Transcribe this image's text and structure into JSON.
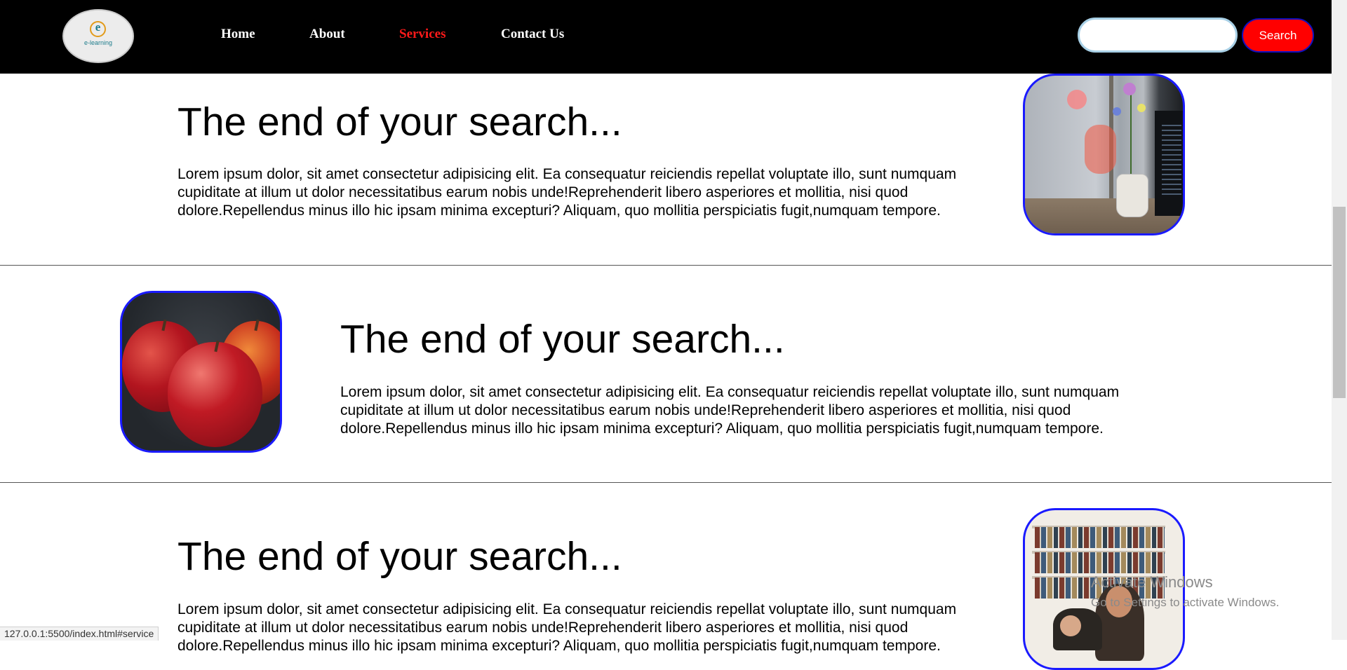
{
  "header": {
    "logo_text": "e-learning",
    "logo_letter": "e",
    "nav": [
      {
        "label": "Home",
        "active": false
      },
      {
        "label": "About",
        "active": false
      },
      {
        "label": "Services",
        "active": true
      },
      {
        "label": "Contact Us",
        "active": false
      }
    ],
    "search": {
      "value": "",
      "placeholder": "",
      "button_label": "Search"
    }
  },
  "sections": [
    {
      "heading": "The end of your search...",
      "text": "Lorem ipsum dolor, sit amet consectetur adipisicing elit. Ea consequatur reiciendis repellat voluptate illo, sunt numquam cupiditate at illum ut dolor necessitatibus earum nobis unde!Reprehenderit libero asperiores et mollitia, nisi quod dolore.Repellendus minus illo hic ipsam minima excepturi? Aliquam, quo mollitia perspiciatis fugit,numquam tempore."
    },
    {
      "heading": "The end of your search...",
      "text": "Lorem ipsum dolor, sit amet consectetur adipisicing elit. Ea consequatur reiciendis repellat voluptate illo, sunt numquam cupiditate at illum ut dolor necessitatibus earum nobis unde!Reprehenderit libero asperiores et mollitia, nisi quod dolore.Repellendus minus illo hic ipsam minima excepturi? Aliquam, quo mollitia perspiciatis fugit,numquam tempore."
    },
    {
      "heading": "The end of your search...",
      "text": "Lorem ipsum dolor, sit amet consectetur adipisicing elit. Ea consequatur reiciendis repellat voluptate illo, sunt numquam cupiditate at illum ut dolor necessitatibus earum nobis unde!Reprehenderit libero asperiores et mollitia, nisi quod dolore.Repellendus minus illo hic ipsam minima excepturi? Aliquam, quo mollitia perspiciatis fugit,numquam tempore."
    }
  ],
  "status_bar": {
    "url": "127.0.0.1:5500/index.html#service"
  },
  "watermark": {
    "line1": "Activate Windows",
    "line2": "Go to Settings to activate Windows."
  },
  "colors": {
    "nav_bg": "#000000",
    "accent": "#ff0000",
    "image_border": "#1a1aff"
  },
  "icons": [
    "e-learning-logo",
    "search-button"
  ]
}
